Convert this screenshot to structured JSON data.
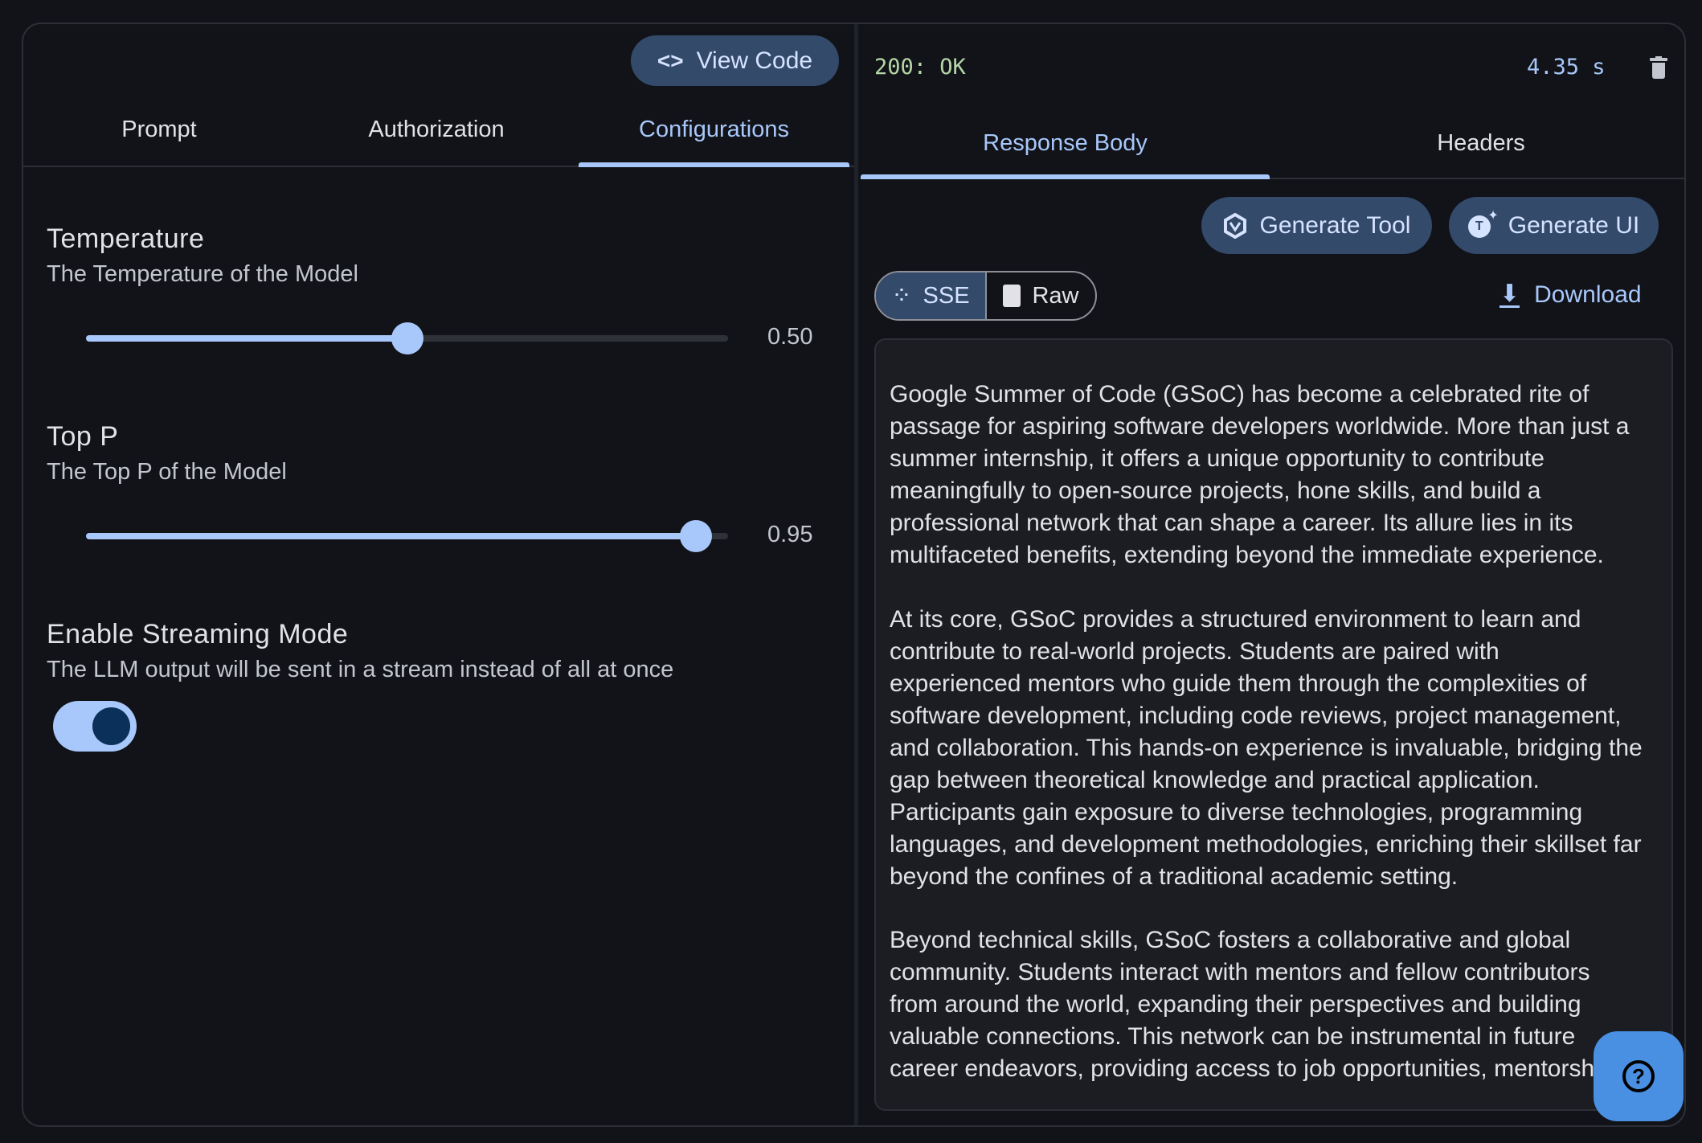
{
  "left": {
    "view_code_label": "View Code",
    "tabs": [
      {
        "label": "Prompt",
        "active": false
      },
      {
        "label": "Authorization",
        "active": false
      },
      {
        "label": "Configurations",
        "active": true
      }
    ],
    "temperature": {
      "label": "Temperature",
      "description": "The Temperature of the Model",
      "value": 0.5,
      "value_text": "0.50"
    },
    "top_p": {
      "label": "Top P",
      "description": "The Top P of the Model",
      "value": 0.95,
      "value_text": "0.95"
    },
    "streaming": {
      "label": "Enable Streaming Mode",
      "description": "The LLM output will be sent in a stream instead of all at once",
      "enabled": true
    }
  },
  "right": {
    "status": "200: OK",
    "duration": "4.35 s",
    "tabs": [
      {
        "label": "Response Body",
        "active": true
      },
      {
        "label": "Headers",
        "active": false
      }
    ],
    "generate_tool_label": "Generate Tool",
    "generate_ui_label": "Generate UI",
    "sse_label": "SSE",
    "raw_label": "Raw",
    "download_label": "Download",
    "body_paragraphs": [
      [
        "Google Summer of Code (GSoC) has become a celebrated rite of",
        "passage for aspiring software developers worldwide. More than just a",
        "summer internship, it offers a unique opportunity to contribute",
        "meaningfully to open-source projects, hone skills, and build a",
        "professional network that can shape a career. Its allure lies in its",
        "multifaceted benefits, extending beyond the immediate experience."
      ],
      [
        "At its core, GSoC provides a structured environment to learn and",
        "contribute to real-world projects. Students are paired with",
        "experienced mentors who guide them through the complexities of",
        "software development, including code reviews, project management,",
        "and collaboration. This hands-on experience is invaluable, bridging the",
        "gap between theoretical knowledge and practical application.",
        "Participants gain exposure to diverse technologies, programming",
        "languages, and development methodologies, enriching their skillset far",
        "beyond the confines of a traditional academic setting."
      ],
      [
        "Beyond technical skills, GSoC fosters a collaborative and global",
        "community. Students interact with mentors and fellow contributors",
        "from around the world, expanding their perspectives and building",
        "valuable connections. This network can be instrumental in future",
        "career endeavors, providing access to job opportunities, mentorship,"
      ]
    ]
  },
  "colors": {
    "accent": "#a8c7fa",
    "button_bg": "#334a6b",
    "status_green": "#b5d6a7",
    "help_button": "#4a90e2",
    "background": "#111318"
  }
}
